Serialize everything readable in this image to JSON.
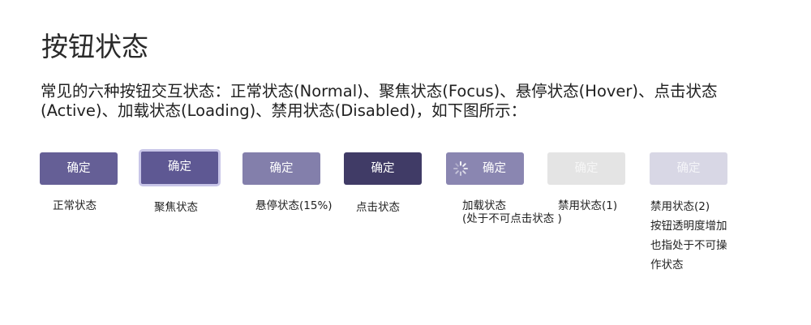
{
  "title": "按钮状态",
  "description": {
    "line1": "常见的六种按钮交互状态：正常状态(Normal)、聚焦状态(Focus)、悬停状态(Hover)、点击状态",
    "line2": "(Active)、加载状态(Loading)、禁用状态(Disabled)，如下图所示："
  },
  "buttons": [
    {
      "label": "确定",
      "caption": "正常状态"
    },
    {
      "label": "确定",
      "caption": "聚焦状态"
    },
    {
      "label": "确定",
      "caption": "悬停状态(15%)"
    },
    {
      "label": "确定",
      "caption": "点击状态"
    },
    {
      "label": "确定",
      "caption_line1": "加载状态",
      "caption_line2": "(处于不可点击状态 )"
    },
    {
      "label": "确定",
      "caption": "禁用状态(1)"
    },
    {
      "label": "确定",
      "caption_lines": [
        "禁用状态(2)",
        "按钮透明度增加",
        "也指处于不可操",
        "作状态"
      ]
    }
  ],
  "colors": {
    "normal": "#655f96",
    "focus": "#5e5893",
    "focus_ring": "#c8c5e8",
    "hover": "#837fab",
    "active": "#403b66",
    "loading": "#8a86b1",
    "disabled1": "#e4e4e4",
    "disabled2": "#d8d7e5"
  },
  "icons": {
    "loading": "loading-spinner-icon"
  }
}
